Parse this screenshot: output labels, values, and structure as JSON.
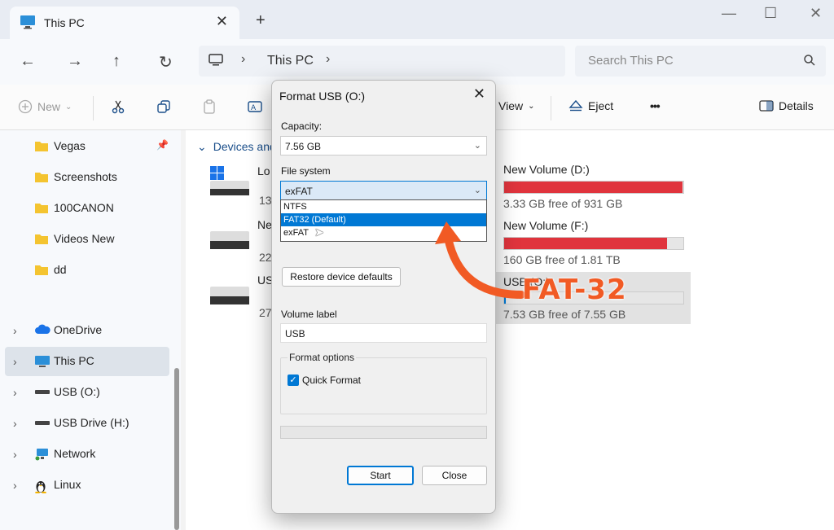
{
  "window": {
    "tab_title": "This PC",
    "tab_close": "✕",
    "new_tab": "+",
    "minimize": "—",
    "maximize": "☐",
    "close": "✕"
  },
  "nav": {
    "back": "←",
    "forward": "→",
    "up": "↑",
    "refresh": "↻",
    "breadcrumb_sep": "›",
    "breadcrumb": "This PC",
    "search_placeholder": "Search This PC"
  },
  "commands": {
    "new": "New",
    "view": "View",
    "eject": "Eject",
    "more": "•••",
    "details": "Details"
  },
  "sidebar": {
    "items": [
      {
        "label": "Vegas",
        "icon": "folder-icon"
      },
      {
        "label": "Screenshots",
        "icon": "folder-icon"
      },
      {
        "label": "100CANON",
        "icon": "folder-icon"
      },
      {
        "label": "Videos New",
        "icon": "folder-icon"
      },
      {
        "label": "dd",
        "icon": "folder-icon"
      },
      {
        "label": "OneDrive",
        "icon": "cloud-icon"
      },
      {
        "label": "This PC",
        "icon": "monitor-icon"
      },
      {
        "label": "USB (O:)",
        "icon": "drive-icon"
      },
      {
        "label": "USB Drive (H:)",
        "icon": "drive-icon"
      },
      {
        "label": "Network",
        "icon": "network-icon"
      },
      {
        "label": "Linux",
        "icon": "linux-icon"
      }
    ]
  },
  "main": {
    "group_title": "Devices and",
    "drives_left": [
      {
        "name": "Lo",
        "free": "13"
      },
      {
        "name": "Ne",
        "free": "22"
      },
      {
        "name": "US",
        "free": "27"
      }
    ],
    "drives_right": [
      {
        "name": "New Volume (D:)",
        "free": "3.33 GB free of 931 GB",
        "used_fraction": 0.996
      },
      {
        "name": "New Volume (F:)",
        "free": "160 GB free of 1.81 TB",
        "used_fraction": 0.91
      },
      {
        "name": "USB (O:)",
        "free": "7.53 GB free of 7.55 GB",
        "used_fraction": 0.003
      }
    ]
  },
  "dialog": {
    "title": "Format USB (O:)",
    "close": "✕",
    "capacity_label": "Capacity:",
    "capacity_value": "7.56 GB",
    "filesystem_label": "File system",
    "filesystem_value": "exFAT",
    "filesystem_options": [
      "NTFS",
      "FAT32 (Default)",
      "exFAT"
    ],
    "highlighted_option": "FAT32 (Default)",
    "restore_button": "Restore device defaults",
    "volume_label_label": "Volume label",
    "volume_label_value": "USB",
    "format_options_title": "Format options",
    "quick_format_label": "Quick Format",
    "quick_format_checked": true,
    "start_button": "Start",
    "close_button": "Close"
  },
  "annotation": {
    "text": "FAT-32",
    "color": "#f15a24"
  },
  "colors": {
    "accent": "#0078d4",
    "drive_bar_full": "#e0343d",
    "drive_bar_normal": "#0078d4"
  }
}
